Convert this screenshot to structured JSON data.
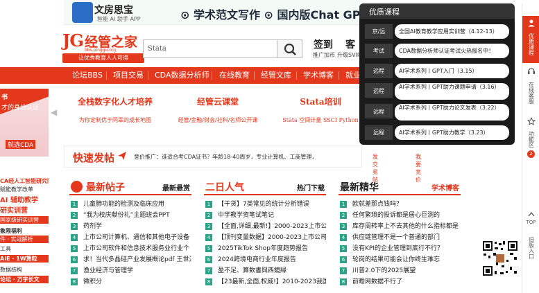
{
  "top_banner": {
    "brand": "文房思宝",
    "brand_sub": "智能 AI 助手 APP",
    "headline": "⊙ 学术范文写作 ⊙ 国内版Chat GP"
  },
  "logo": {
    "mark": "JG",
    "name": "经管之家",
    "url": "bbs.pinggu.org",
    "slogan": "让优秀教育人人可得"
  },
  "search": {
    "placeholder": "Stata"
  },
  "header_links": {
    "signin": "签到",
    "signin_sub": "推广加币",
    "kefu": "客",
    "kefu_sub": "升级SVIP"
  },
  "nav": [
    "论坛BBS",
    "项目交易",
    "CDA数据分析师",
    "在线教育",
    "经管文库",
    "学术博客",
    "就业"
  ],
  "left_promo": {
    "lines": [
      "书",
      "才的身份认证",
      "就选CDA"
    ]
  },
  "services": [
    {
      "title": "全栈数字化人才培养",
      "subtitle": "为你定制优于同辈的成长地图"
    },
    {
      "title": "经管云课堂",
      "subtitle": "经管/金融/财会/社科/名师公开课"
    },
    {
      "title": "Stata培训",
      "subtitle": "Stata 空间计量 SSCI Python"
    }
  ],
  "quick_post": {
    "label": "快速发帖",
    "ad_prefix": "竞价推广：",
    "ad_text": "谁适合考CDA证书？年龄18-40周岁，专业计算机、工商管理，",
    "links": [
      "发交易帖",
      "我要竞价"
    ]
  },
  "left_side_ads": [
    "CA经人工智能研究院",
    "赋能教学改革",
    "AI 辅助教学",
    "研实训营",
    "国家级研实训营",
    "象限福利",
    "件 · 实战解析",
    "工具",
    "AIE · 1W算粒",
    "数据结构",
    "论坛 · 万字长文"
  ],
  "columns": [
    {
      "title": "最新帖子",
      "more": "最新悬赏",
      "items": [
        "儿童肺功能的检测及临床应用",
        "“我为校庆献份礼”主题班会PPT",
        "药剂学",
        "上市公司计算机、通信和其他电子设备",
        "上市公司软件和信息技术服务业行业个",
        "求！当代多晶硅产业发展概论pdf 王世江",
        "渔业经济与管理学",
        "微积分",
        "..."
      ]
    },
    {
      "title": "二日人气",
      "more": "热门下载",
      "items": [
        "【干货】7类常见的统计分析错误",
        "中学教学资笔试笔记",
        "【全面,详细,最新!】2000-2023上市公司",
        "【顶刊变量数据】2000-2023上市公司",
        "2025TikTok Shop年度趋势报告",
        "2024跨境电商行业年度报告",
        "盈不足、算数書與西鏡緑",
        "【23最新,全面,权威!】2010-2023我国商",
        "..."
      ]
    },
    {
      "title": "最新精华",
      "more": "学术博客",
      "items": [
        "欧就差那点钱吗？",
        "任何繁琐的投诉都是居心巨测的",
        "库存周转率上不去其他的什么指标都是",
        "供应链管理不是一个普通的部门",
        "没有KPI的企业管理到底行不行？",
        "轮岗的结果可能会让你终生难忘",
        "川普2.0下的2025展望",
        "前瞻网数据不行了",
        "..."
      ]
    }
  ],
  "popup": {
    "title": "优质课程",
    "rows": [
      {
        "tag": "京/远",
        "text": "全国AI教育教学应用实训营（4.12-13）",
        "color": "#3a3a3a"
      },
      {
        "tag": "考试",
        "text": "CDA数据分析师认证考试火热报名中！",
        "color": "#3a3a3a"
      },
      {
        "tag": "远程",
        "text": "AI学术系列丨GPT入门（3.15）",
        "color": "#3a3a3a"
      },
      {
        "tag": "远程",
        "text": "AI学术系列丨GPT助力课题申请（3.16）",
        "color": "#3a3a3a"
      },
      {
        "tag": "远程",
        "text": "AI学术系列丨GPT助力论文发表（3.22）",
        "color": "#3a3a3a"
      },
      {
        "tag": "远程",
        "text": "AI学术系列丨GPT助力教学（3.23）",
        "color": "#3a3a3a"
      }
    ]
  },
  "right_bar": {
    "items": [
      "优质课程",
      "在线客服",
      "功能区",
      "TOP",
      "旧版入口"
    ],
    "badge": "2"
  },
  "colors": {
    "brand_red": "#e4381d",
    "teal": "#2aa388"
  }
}
